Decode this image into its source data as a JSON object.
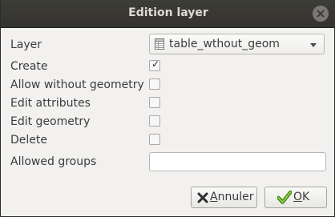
{
  "window": {
    "title": "Edition layer"
  },
  "form": {
    "layer_label": "Layer",
    "layer_value": "table_wthout_geom",
    "create_label": "Create",
    "create_checked": true,
    "allow_without_geometry_label": "Allow without geometry",
    "allow_without_geometry_checked": false,
    "edit_attributes_label": "Edit attributes",
    "edit_attributes_checked": false,
    "edit_geometry_label": "Edit geometry",
    "edit_geometry_checked": false,
    "delete_label": "Delete",
    "delete_checked": false,
    "allowed_groups_label": "Allowed groups",
    "allowed_groups_value": ""
  },
  "buttons": {
    "cancel_mnemonic": "A",
    "cancel_rest": "nnuler",
    "ok_mnemonic": "O",
    "ok_rest": "K"
  },
  "icons": {
    "close": "close-icon",
    "layer": "table-icon",
    "cancel": "cross-icon",
    "ok": "checkmark-icon"
  },
  "colors": {
    "titlebar": "#3c3b37",
    "background": "#f2f1f0",
    "ok_check": "#4e9a06",
    "cancel_cross": "#2e2e2e"
  }
}
